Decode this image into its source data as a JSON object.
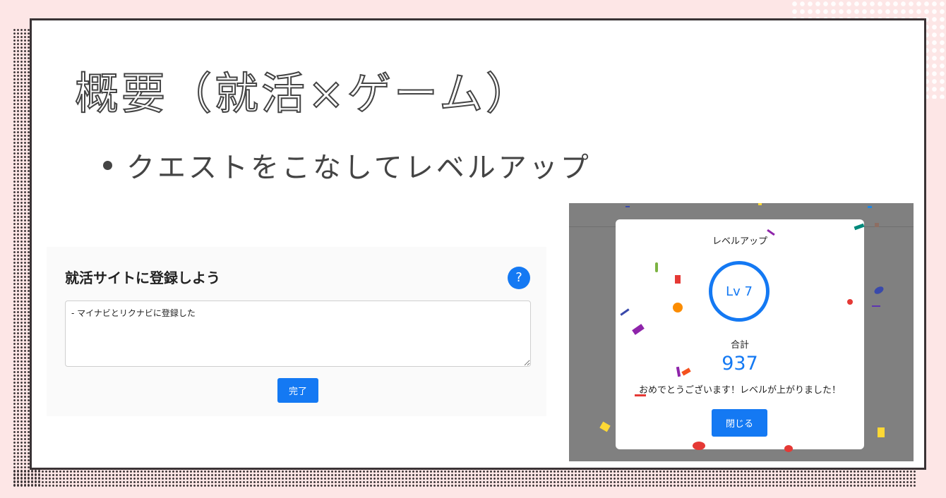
{
  "slide": {
    "title": "概要（就活×ゲーム）",
    "bullet": "クエストをこなしてレベルアップ"
  },
  "quest_screen": {
    "title": "就活サイトに登録しよう",
    "help_label": "?",
    "textarea_value": "- マイナビとリクナビに登録した",
    "done_label": "完了"
  },
  "levelup_screen": {
    "modal_title": "レベルアップ",
    "level_label": "Lv 7",
    "total_label": "合計",
    "total_value": "937",
    "message": "おめでとうございます！レベルが上がりました！",
    "close_label": "閉じる"
  },
  "colors": {
    "accent": "#1479f3",
    "background": "#fde6e6",
    "dots": "#3a3335",
    "overlay": "#808080"
  }
}
